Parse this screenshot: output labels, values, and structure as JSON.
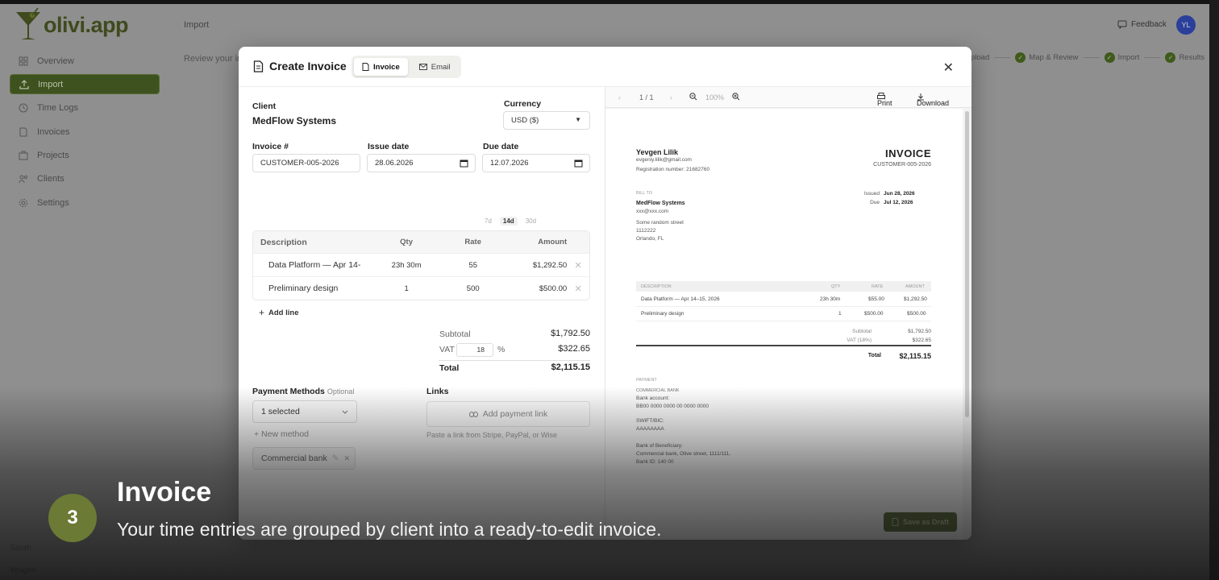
{
  "app": {
    "logo_text": "olivi.app",
    "breadcrumb": "Import",
    "review_text": "Review your im",
    "feedback_label": "Feedback",
    "avatar_initials": "YL",
    "nav": [
      {
        "label": "Overview",
        "icon": "grid-icon"
      },
      {
        "label": "Import",
        "icon": "upload-icon",
        "active": true
      },
      {
        "label": "Time Logs",
        "icon": "clock-icon"
      },
      {
        "label": "Invoices",
        "icon": "file-icon"
      },
      {
        "label": "Projects",
        "icon": "folder-icon"
      },
      {
        "label": "Clients",
        "icon": "users-icon"
      },
      {
        "label": "Settings",
        "icon": "gear-icon"
      }
    ],
    "steps": [
      {
        "label": "pload"
      },
      {
        "label": "Map & Review"
      },
      {
        "label": "Import"
      },
      {
        "label": "Results"
      }
    ],
    "bottom_ghost_1": "Sarah",
    "bottom_ghost_2": "Yevgen"
  },
  "modal": {
    "title": "Create Invoice",
    "tabs": [
      "Invoice",
      "Email"
    ],
    "client_label": "Client",
    "client_value": "MedFlow Systems",
    "currency_label": "Currency",
    "currency_value": "USD ($)",
    "invoice_no_label": "Invoice #",
    "invoice_no_value": "CUSTOMER-005-2026",
    "issue_date_label": "Issue date",
    "issue_date_value": "28.06.2026",
    "due_date_label": "Due date",
    "due_date_value": "12.07.2026",
    "due_chips": [
      "7d",
      "14d",
      "30d"
    ],
    "table": {
      "headers": [
        "Description",
        "Qty",
        "Rate",
        "Amount"
      ],
      "rows": [
        {
          "description": "Data Platform — Apr 14-",
          "qty": "23h 30m",
          "rate": "55",
          "amount": "$1,292.50"
        },
        {
          "description": "Preliminary design",
          "qty": "1",
          "rate": "500",
          "amount": "$500.00"
        }
      ]
    },
    "add_line": "Add line",
    "subtotal_label": "Subtotal",
    "subtotal_value": "$1,792.50",
    "vat_label": "VAT",
    "vat_rate": "18",
    "vat_pct": "%",
    "vat_value": "$322.65",
    "total_label": "Total",
    "total_value": "$2,115.15",
    "payment_methods_label": "Payment Methods",
    "payment_optional": "Optional",
    "payment_select": "1 selected",
    "new_method": "+ New method",
    "payment_chip": "Commercial bank",
    "links_label": "Links",
    "add_payment_link": "Add payment link",
    "links_hint": "Paste a link from Stripe, PayPal, or Wise",
    "save_draft": "Save as Draft"
  },
  "preview": {
    "page_indicator": "1 / 1",
    "zoom": "100%",
    "print_label": "Print",
    "download_label": "Download",
    "from_name": "Yevgen Lilik",
    "from_email": "evgeniy.lilik@gmail.com",
    "from_reg": "Registration number: 21682760",
    "doc_title": "INVOICE",
    "doc_number": "CUSTOMER-005-2026",
    "bill_to_label": "BILL TO",
    "bill_name": "MedFlow Systems",
    "bill_email": "xxx@xxx.com",
    "bill_street": "Some random street",
    "bill_zip": "1112222",
    "bill_city": "Orlando, FL",
    "issued_label": "Issued",
    "issued_value": "Jun 28, 2026",
    "due_label": "Due",
    "due_value": "Jul 12, 2026",
    "table_headers": [
      "DESCRIPTION",
      "QTY",
      "RATE",
      "AMOUNT"
    ],
    "rows": [
      {
        "description": "Data Platform — Apr 14–15, 2026",
        "qty": "23h 30m",
        "rate": "$55.00",
        "amount": "$1,292.50"
      },
      {
        "description": "Preliminary design",
        "qty": "1",
        "rate": "$500.00",
        "amount": "$500.00"
      }
    ],
    "subtotal_label": "Subtotal",
    "subtotal_value": "$1,792.50",
    "vat_label": "VAT (18%)",
    "vat_value": "$322.65",
    "total_label": "Total",
    "total_value": "$2,115.15",
    "payment_label": "PAYMENT",
    "bank_name": "COMMERCIAL BANK",
    "bank_account_label": "Bank account:",
    "bank_account_value": "BB00 0000 0000 00 0000 0000",
    "swift_label": "SWIFT/BIC:",
    "swift_value": "AAAAAAAA",
    "beneficiary_label": "Bank of Beneficiary:",
    "beneficiary_value": "Commercial bank, Olive street, 1111/111,",
    "bank_id": "Bank ID: 140 00"
  },
  "caption": {
    "step_number": "3",
    "title": "Invoice",
    "subtitle": "Your time entries are grouped by client into a ready-to-edit invoice."
  },
  "colors": {
    "brand_olive": "#6b7a34",
    "nav_active": "#3e5220"
  }
}
